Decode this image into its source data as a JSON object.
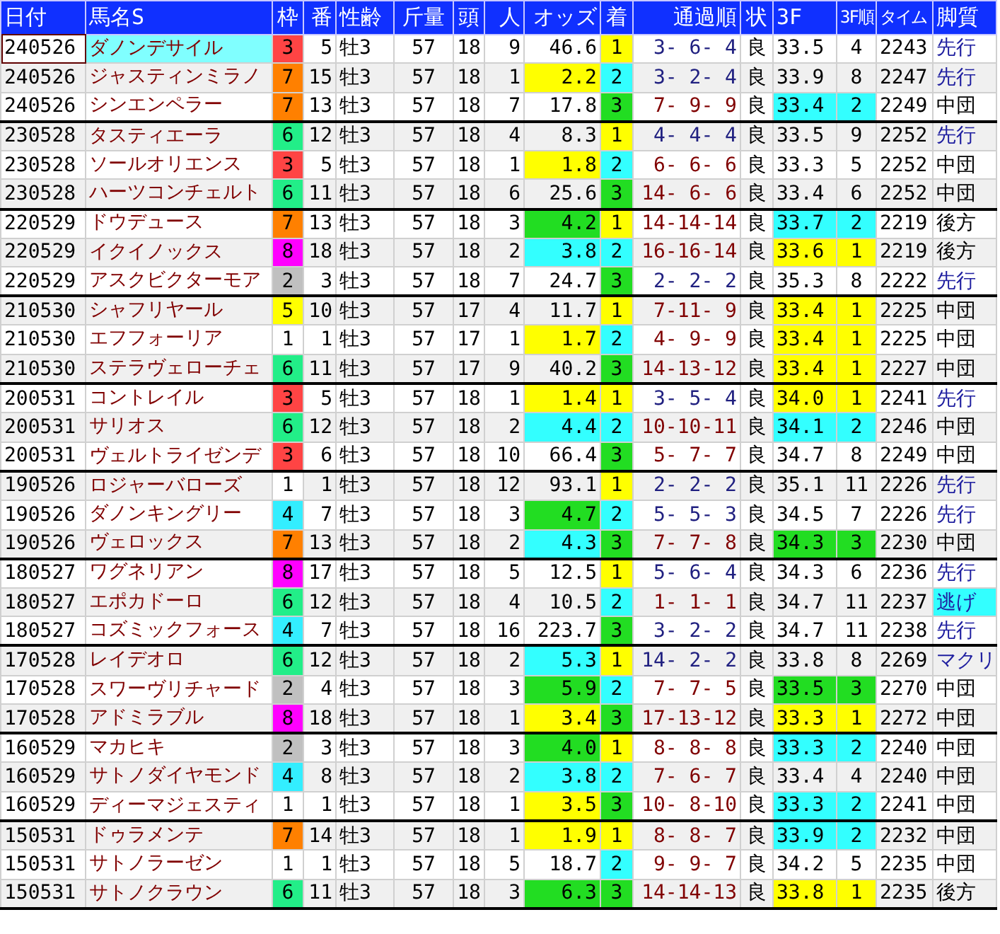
{
  "columns": [
    "日付",
    "馬名S",
    "枠",
    "番",
    "性齢",
    "斤量",
    "頭",
    "人",
    "オッズ",
    "着",
    "通過順",
    "状",
    "3F",
    "3F順",
    "タイム",
    "脚質"
  ],
  "races": [
    {
      "rows": [
        {
          "date": "240526",
          "name": "ダノンデサイル",
          "selected": true,
          "frame": {
            "text": "3",
            "color": "#ff4444"
          },
          "num": "5",
          "sex_age": "牡3",
          "weight": "57",
          "runners": "18",
          "pop": "9",
          "odds": {
            "text": "46.6"
          },
          "finish": {
            "text": "1",
            "color": "#ffff00"
          },
          "passing": {
            "text": "3- 6- 4",
            "color": "#202080"
          },
          "going": "良",
          "f3": {
            "text": "33.5"
          },
          "f3_rank": {
            "text": "4"
          },
          "time": "2243",
          "style": {
            "text": "先行",
            "color": "#2020a0",
            "highlighted": false
          }
        },
        {
          "date": "240526",
          "name": "ジャスティンミラノ",
          "selected": false,
          "frame": {
            "text": "7",
            "color": "#ff8000"
          },
          "num": "15",
          "sex_age": "牡3",
          "weight": "57",
          "runners": "18",
          "pop": "1",
          "odds": {
            "text": "2.2",
            "color": "#ffff00"
          },
          "finish": {
            "text": "2",
            "color": "#33ffff"
          },
          "passing": {
            "text": "3- 2- 4",
            "color": "#202080"
          },
          "going": "良",
          "f3": {
            "text": "33.9"
          },
          "f3_rank": {
            "text": "8"
          },
          "time": "2247",
          "style": {
            "text": "先行",
            "color": "#2020a0",
            "highlighted": false
          }
        },
        {
          "date": "240526",
          "name": "シンエンペラー",
          "selected": false,
          "frame": {
            "text": "7",
            "color": "#ff8000"
          },
          "num": "13",
          "sex_age": "牡3",
          "weight": "57",
          "runners": "18",
          "pop": "7",
          "odds": {
            "text": "17.8"
          },
          "finish": {
            "text": "3",
            "color": "#22dd22"
          },
          "passing": {
            "text": "7- 9- 9",
            "color": "#800000"
          },
          "going": "良",
          "f3": {
            "text": "33.4",
            "color": "#33ffff"
          },
          "f3_rank": {
            "text": "2",
            "color": "#33ffff"
          },
          "time": "2249",
          "style": {
            "text": "中団",
            "color": "#000000",
            "highlighted": false
          }
        }
      ]
    },
    {
      "rows": [
        {
          "date": "230528",
          "name": "タスティエーラ",
          "selected": false,
          "frame": {
            "text": "6",
            "color": "#22ee88"
          },
          "num": "12",
          "sex_age": "牡3",
          "weight": "57",
          "runners": "18",
          "pop": "4",
          "odds": {
            "text": "8.3"
          },
          "finish": {
            "text": "1",
            "color": "#ffff00"
          },
          "passing": {
            "text": "4- 4- 4",
            "color": "#202080"
          },
          "going": "良",
          "f3": {
            "text": "33.5"
          },
          "f3_rank": {
            "text": "9"
          },
          "time": "2252",
          "style": {
            "text": "先行",
            "color": "#2020a0",
            "highlighted": false
          }
        },
        {
          "date": "230528",
          "name": "ソールオリエンス",
          "selected": false,
          "frame": {
            "text": "3",
            "color": "#ff4444"
          },
          "num": "5",
          "sex_age": "牡3",
          "weight": "57",
          "runners": "18",
          "pop": "1",
          "odds": {
            "text": "1.8",
            "color": "#ffff00"
          },
          "finish": {
            "text": "2",
            "color": "#33ffff"
          },
          "passing": {
            "text": "6- 6- 6",
            "color": "#800000"
          },
          "going": "良",
          "f3": {
            "text": "33.3"
          },
          "f3_rank": {
            "text": "5"
          },
          "time": "2252",
          "style": {
            "text": "中団",
            "color": "#000000",
            "highlighted": false
          }
        },
        {
          "date": "230528",
          "name": "ハーツコンチェルト",
          "selected": false,
          "frame": {
            "text": "6",
            "color": "#22ee88"
          },
          "num": "11",
          "sex_age": "牡3",
          "weight": "57",
          "runners": "18",
          "pop": "6",
          "odds": {
            "text": "25.6"
          },
          "finish": {
            "text": "3",
            "color": "#22dd22"
          },
          "passing": {
            "text": "14- 6- 6",
            "color": "#800000"
          },
          "going": "良",
          "f3": {
            "text": "33.4"
          },
          "f3_rank": {
            "text": "6"
          },
          "time": "2252",
          "style": {
            "text": "中団",
            "color": "#000000",
            "highlighted": false
          }
        }
      ]
    },
    {
      "rows": [
        {
          "date": "220529",
          "name": "ドウデュース",
          "selected": false,
          "frame": {
            "text": "7",
            "color": "#ff8000"
          },
          "num": "13",
          "sex_age": "牡3",
          "weight": "57",
          "runners": "18",
          "pop": "3",
          "odds": {
            "text": "4.2",
            "color": "#22dd22"
          },
          "finish": {
            "text": "1",
            "color": "#ffff00"
          },
          "passing": {
            "text": "14-14-14",
            "color": "#800000"
          },
          "going": "良",
          "f3": {
            "text": "33.7",
            "color": "#33ffff"
          },
          "f3_rank": {
            "text": "2",
            "color": "#33ffff"
          },
          "time": "2219",
          "style": {
            "text": "後方",
            "color": "#000000",
            "highlighted": false
          }
        },
        {
          "date": "220529",
          "name": "イクイノックス",
          "selected": false,
          "frame": {
            "text": "8",
            "color": "#ff00ff"
          },
          "num": "18",
          "sex_age": "牡3",
          "weight": "57",
          "runners": "18",
          "pop": "2",
          "odds": {
            "text": "3.8",
            "color": "#33ffff"
          },
          "finish": {
            "text": "2",
            "color": "#33ffff"
          },
          "passing": {
            "text": "16-16-14",
            "color": "#800000"
          },
          "going": "良",
          "f3": {
            "text": "33.6",
            "color": "#ffff00"
          },
          "f3_rank": {
            "text": "1",
            "color": "#ffff00"
          },
          "time": "2219",
          "style": {
            "text": "後方",
            "color": "#000000",
            "highlighted": false
          }
        },
        {
          "date": "220529",
          "name": "アスクビクターモア",
          "selected": false,
          "frame": {
            "text": "2",
            "color": "#c0c0c0"
          },
          "num": "3",
          "sex_age": "牡3",
          "weight": "57",
          "runners": "18",
          "pop": "7",
          "odds": {
            "text": "24.7"
          },
          "finish": {
            "text": "3",
            "color": "#22dd22"
          },
          "passing": {
            "text": "2- 2- 2",
            "color": "#202080"
          },
          "going": "良",
          "f3": {
            "text": "35.3"
          },
          "f3_rank": {
            "text": "8"
          },
          "time": "2222",
          "style": {
            "text": "先行",
            "color": "#2020a0",
            "highlighted": false
          }
        }
      ]
    },
    {
      "rows": [
        {
          "date": "210530",
          "name": "シャフリヤール",
          "selected": false,
          "frame": {
            "text": "5",
            "color": "#ffff00"
          },
          "num": "10",
          "sex_age": "牡3",
          "weight": "57",
          "runners": "17",
          "pop": "4",
          "odds": {
            "text": "11.7"
          },
          "finish": {
            "text": "1",
            "color": "#ffff00"
          },
          "passing": {
            "text": "7-11- 9",
            "color": "#800000"
          },
          "going": "良",
          "f3": {
            "text": "33.4",
            "color": "#ffff00"
          },
          "f3_rank": {
            "text": "1",
            "color": "#ffff00"
          },
          "time": "2225",
          "style": {
            "text": "中団",
            "color": "#000000",
            "highlighted": false
          }
        },
        {
          "date": "210530",
          "name": "エフフォーリア",
          "selected": false,
          "frame": {
            "text": "1",
            "color": "#ffffff"
          },
          "num": "1",
          "sex_age": "牡3",
          "weight": "57",
          "runners": "17",
          "pop": "1",
          "odds": {
            "text": "1.7",
            "color": "#ffff00"
          },
          "finish": {
            "text": "2",
            "color": "#33ffff"
          },
          "passing": {
            "text": "4- 9- 9",
            "color": "#800000"
          },
          "going": "良",
          "f3": {
            "text": "33.4",
            "color": "#ffff00"
          },
          "f3_rank": {
            "text": "1",
            "color": "#ffff00"
          },
          "time": "2225",
          "style": {
            "text": "中団",
            "color": "#000000",
            "highlighted": false
          }
        },
        {
          "date": "210530",
          "name": "ステラヴェローチェ",
          "selected": false,
          "frame": {
            "text": "6",
            "color": "#22ee88"
          },
          "num": "11",
          "sex_age": "牡3",
          "weight": "57",
          "runners": "17",
          "pop": "9",
          "odds": {
            "text": "40.2"
          },
          "finish": {
            "text": "3",
            "color": "#22dd22"
          },
          "passing": {
            "text": "14-13-12",
            "color": "#800000"
          },
          "going": "良",
          "f3": {
            "text": "33.4",
            "color": "#ffff00"
          },
          "f3_rank": {
            "text": "1",
            "color": "#ffff00"
          },
          "time": "2227",
          "style": {
            "text": "中団",
            "color": "#000000",
            "highlighted": false
          }
        }
      ]
    },
    {
      "rows": [
        {
          "date": "200531",
          "name": "コントレイル",
          "selected": false,
          "frame": {
            "text": "3",
            "color": "#ff4444"
          },
          "num": "5",
          "sex_age": "牡3",
          "weight": "57",
          "runners": "18",
          "pop": "1",
          "odds": {
            "text": "1.4",
            "color": "#ffff00"
          },
          "finish": {
            "text": "1",
            "color": "#ffff00"
          },
          "passing": {
            "text": "3- 5- 4",
            "color": "#202080"
          },
          "going": "良",
          "f3": {
            "text": "34.0",
            "color": "#ffff00"
          },
          "f3_rank": {
            "text": "1",
            "color": "#ffff00"
          },
          "time": "2241",
          "style": {
            "text": "先行",
            "color": "#2020a0",
            "highlighted": false
          }
        },
        {
          "date": "200531",
          "name": "サリオス",
          "selected": false,
          "frame": {
            "text": "6",
            "color": "#22ee88"
          },
          "num": "12",
          "sex_age": "牡3",
          "weight": "57",
          "runners": "18",
          "pop": "2",
          "odds": {
            "text": "4.4",
            "color": "#33ffff"
          },
          "finish": {
            "text": "2",
            "color": "#33ffff"
          },
          "passing": {
            "text": "10-10-11",
            "color": "#800000"
          },
          "going": "良",
          "f3": {
            "text": "34.1",
            "color": "#33ffff"
          },
          "f3_rank": {
            "text": "2",
            "color": "#33ffff"
          },
          "time": "2246",
          "style": {
            "text": "中団",
            "color": "#000000",
            "highlighted": false
          }
        },
        {
          "date": "200531",
          "name": "ヴェルトライゼンデ",
          "selected": false,
          "frame": {
            "text": "3",
            "color": "#ff4444"
          },
          "num": "6",
          "sex_age": "牡3",
          "weight": "57",
          "runners": "18",
          "pop": "10",
          "odds": {
            "text": "66.4"
          },
          "finish": {
            "text": "3",
            "color": "#22dd22"
          },
          "passing": {
            "text": "5- 7- 7",
            "color": "#800000"
          },
          "going": "良",
          "f3": {
            "text": "34.7"
          },
          "f3_rank": {
            "text": "8"
          },
          "time": "2249",
          "style": {
            "text": "中団",
            "color": "#000000",
            "highlighted": false
          }
        }
      ]
    },
    {
      "rows": [
        {
          "date": "190526",
          "name": "ロジャーバローズ",
          "selected": false,
          "frame": {
            "text": "1",
            "color": "#ffffff"
          },
          "num": "1",
          "sex_age": "牡3",
          "weight": "57",
          "runners": "18",
          "pop": "12",
          "odds": {
            "text": "93.1"
          },
          "finish": {
            "text": "1",
            "color": "#ffff00"
          },
          "passing": {
            "text": "2- 2- 2",
            "color": "#202080"
          },
          "going": "良",
          "f3": {
            "text": "35.1"
          },
          "f3_rank": {
            "text": "11"
          },
          "time": "2226",
          "style": {
            "text": "先行",
            "color": "#2020a0",
            "highlighted": false
          }
        },
        {
          "date": "190526",
          "name": "ダノンキングリー",
          "selected": false,
          "frame": {
            "text": "4",
            "color": "#33eeff"
          },
          "num": "7",
          "sex_age": "牡3",
          "weight": "57",
          "runners": "18",
          "pop": "3",
          "odds": {
            "text": "4.7",
            "color": "#22dd22"
          },
          "finish": {
            "text": "2",
            "color": "#33ffff"
          },
          "passing": {
            "text": "5- 5- 3",
            "color": "#202080"
          },
          "going": "良",
          "f3": {
            "text": "34.5"
          },
          "f3_rank": {
            "text": "7"
          },
          "time": "2226",
          "style": {
            "text": "先行",
            "color": "#2020a0",
            "highlighted": false
          }
        },
        {
          "date": "190526",
          "name": "ヴェロックス",
          "selected": false,
          "frame": {
            "text": "7",
            "color": "#ff8000"
          },
          "num": "13",
          "sex_age": "牡3",
          "weight": "57",
          "runners": "18",
          "pop": "2",
          "odds": {
            "text": "4.3",
            "color": "#33ffff"
          },
          "finish": {
            "text": "3",
            "color": "#22dd22"
          },
          "passing": {
            "text": "7- 7- 8",
            "color": "#800000"
          },
          "going": "良",
          "f3": {
            "text": "34.3",
            "color": "#22dd22"
          },
          "f3_rank": {
            "text": "3",
            "color": "#22dd22"
          },
          "time": "2230",
          "style": {
            "text": "中団",
            "color": "#000000",
            "highlighted": false
          }
        }
      ]
    },
    {
      "rows": [
        {
          "date": "180527",
          "name": "ワグネリアン",
          "selected": false,
          "frame": {
            "text": "8",
            "color": "#ff00ff"
          },
          "num": "17",
          "sex_age": "牡3",
          "weight": "57",
          "runners": "18",
          "pop": "5",
          "odds": {
            "text": "12.5"
          },
          "finish": {
            "text": "1",
            "color": "#ffff00"
          },
          "passing": {
            "text": "5- 6- 4",
            "color": "#202080"
          },
          "going": "良",
          "f3": {
            "text": "34.3"
          },
          "f3_rank": {
            "text": "6"
          },
          "time": "2236",
          "style": {
            "text": "先行",
            "color": "#2020a0",
            "highlighted": false
          }
        },
        {
          "date": "180527",
          "name": "エポカドーロ",
          "selected": false,
          "frame": {
            "text": "6",
            "color": "#22ee88"
          },
          "num": "12",
          "sex_age": "牡3",
          "weight": "57",
          "runners": "18",
          "pop": "4",
          "odds": {
            "text": "10.5"
          },
          "finish": {
            "text": "2",
            "color": "#33ffff"
          },
          "passing": {
            "text": "1- 1- 1",
            "color": "#800000"
          },
          "going": "良",
          "f3": {
            "text": "34.7"
          },
          "f3_rank": {
            "text": "11"
          },
          "time": "2237",
          "style": {
            "text": "逃げ",
            "color": "#2020a0",
            "highlighted": true
          }
        },
        {
          "date": "180527",
          "name": "コズミックフォース",
          "selected": false,
          "frame": {
            "text": "4",
            "color": "#33eeff"
          },
          "num": "7",
          "sex_age": "牡3",
          "weight": "57",
          "runners": "18",
          "pop": "16",
          "odds": {
            "text": "223.7"
          },
          "finish": {
            "text": "3",
            "color": "#22dd22"
          },
          "passing": {
            "text": "3- 2- 2",
            "color": "#202080"
          },
          "going": "良",
          "f3": {
            "text": "34.7"
          },
          "f3_rank": {
            "text": "11"
          },
          "time": "2238",
          "style": {
            "text": "先行",
            "color": "#2020a0",
            "highlighted": false
          }
        }
      ]
    },
    {
      "rows": [
        {
          "date": "170528",
          "name": "レイデオロ",
          "selected": false,
          "frame": {
            "text": "6",
            "color": "#22ee88"
          },
          "num": "12",
          "sex_age": "牡3",
          "weight": "57",
          "runners": "18",
          "pop": "2",
          "odds": {
            "text": "5.3",
            "color": "#33ffff"
          },
          "finish": {
            "text": "1",
            "color": "#ffff00"
          },
          "passing": {
            "text": "14- 2- 2",
            "color": "#202080"
          },
          "going": "良",
          "f3": {
            "text": "33.8"
          },
          "f3_rank": {
            "text": "8"
          },
          "time": "2269",
          "style": {
            "text": "マクリ",
            "color": "#2020a0",
            "highlighted": false
          }
        },
        {
          "date": "170528",
          "name": "スワーヴリチャード",
          "selected": false,
          "frame": {
            "text": "2",
            "color": "#c0c0c0"
          },
          "num": "4",
          "sex_age": "牡3",
          "weight": "57",
          "runners": "18",
          "pop": "3",
          "odds": {
            "text": "5.9",
            "color": "#22dd22"
          },
          "finish": {
            "text": "2",
            "color": "#33ffff"
          },
          "passing": {
            "text": "7- 7- 5",
            "color": "#800000"
          },
          "going": "良",
          "f3": {
            "text": "33.5",
            "color": "#22dd22"
          },
          "f3_rank": {
            "text": "3",
            "color": "#22dd22"
          },
          "time": "2270",
          "style": {
            "text": "中団",
            "color": "#000000",
            "highlighted": false
          }
        },
        {
          "date": "170528",
          "name": "アドミラブル",
          "selected": false,
          "frame": {
            "text": "8",
            "color": "#ff00ff"
          },
          "num": "18",
          "sex_age": "牡3",
          "weight": "57",
          "runners": "18",
          "pop": "1",
          "odds": {
            "text": "3.4",
            "color": "#ffff00"
          },
          "finish": {
            "text": "3",
            "color": "#22dd22"
          },
          "passing": {
            "text": "17-13-12",
            "color": "#800000"
          },
          "going": "良",
          "f3": {
            "text": "33.3",
            "color": "#ffff00"
          },
          "f3_rank": {
            "text": "1",
            "color": "#ffff00"
          },
          "time": "2272",
          "style": {
            "text": "中団",
            "color": "#000000",
            "highlighted": false
          }
        }
      ]
    },
    {
      "rows": [
        {
          "date": "160529",
          "name": "マカヒキ",
          "selected": false,
          "frame": {
            "text": "2",
            "color": "#c0c0c0"
          },
          "num": "3",
          "sex_age": "牡3",
          "weight": "57",
          "runners": "18",
          "pop": "3",
          "odds": {
            "text": "4.0",
            "color": "#22dd22"
          },
          "finish": {
            "text": "1",
            "color": "#ffff00"
          },
          "passing": {
            "text": "8- 8- 8",
            "color": "#800000"
          },
          "going": "良",
          "f3": {
            "text": "33.3",
            "color": "#33ffff"
          },
          "f3_rank": {
            "text": "2",
            "color": "#33ffff"
          },
          "time": "2240",
          "style": {
            "text": "中団",
            "color": "#000000",
            "highlighted": false
          }
        },
        {
          "date": "160529",
          "name": "サトノダイヤモンド",
          "selected": false,
          "frame": {
            "text": "4",
            "color": "#33eeff"
          },
          "num": "8",
          "sex_age": "牡3",
          "weight": "57",
          "runners": "18",
          "pop": "2",
          "odds": {
            "text": "3.8",
            "color": "#33ffff"
          },
          "finish": {
            "text": "2",
            "color": "#33ffff"
          },
          "passing": {
            "text": "7- 6- 7",
            "color": "#800000"
          },
          "going": "良",
          "f3": {
            "text": "33.4"
          },
          "f3_rank": {
            "text": "4"
          },
          "time": "2240",
          "style": {
            "text": "中団",
            "color": "#000000",
            "highlighted": false
          }
        },
        {
          "date": "160529",
          "name": "ディーマジェスティ",
          "selected": false,
          "frame": {
            "text": "1",
            "color": "#ffffff"
          },
          "num": "1",
          "sex_age": "牡3",
          "weight": "57",
          "runners": "18",
          "pop": "1",
          "odds": {
            "text": "3.5",
            "color": "#ffff00"
          },
          "finish": {
            "text": "3",
            "color": "#22dd22"
          },
          "passing": {
            "text": "10- 8-10",
            "color": "#800000"
          },
          "going": "良",
          "f3": {
            "text": "33.3",
            "color": "#33ffff"
          },
          "f3_rank": {
            "text": "2",
            "color": "#33ffff"
          },
          "time": "2241",
          "style": {
            "text": "中団",
            "color": "#000000",
            "highlighted": false
          }
        }
      ]
    },
    {
      "rows": [
        {
          "date": "150531",
          "name": "ドゥラメンテ",
          "selected": false,
          "frame": {
            "text": "7",
            "color": "#ff8000"
          },
          "num": "14",
          "sex_age": "牡3",
          "weight": "57",
          "runners": "18",
          "pop": "1",
          "odds": {
            "text": "1.9",
            "color": "#ffff00"
          },
          "finish": {
            "text": "1",
            "color": "#ffff00"
          },
          "passing": {
            "text": "8- 8- 7",
            "color": "#800000"
          },
          "going": "良",
          "f3": {
            "text": "33.9",
            "color": "#33ffff"
          },
          "f3_rank": {
            "text": "2",
            "color": "#33ffff"
          },
          "time": "2232",
          "style": {
            "text": "中団",
            "color": "#000000",
            "highlighted": false
          }
        },
        {
          "date": "150531",
          "name": "サトノラーゼン",
          "selected": false,
          "frame": {
            "text": "1",
            "color": "#ffffff"
          },
          "num": "1",
          "sex_age": "牡3",
          "weight": "57",
          "runners": "18",
          "pop": "5",
          "odds": {
            "text": "18.7"
          },
          "finish": {
            "text": "2",
            "color": "#33ffff"
          },
          "passing": {
            "text": "9- 9- 7",
            "color": "#800000"
          },
          "going": "良",
          "f3": {
            "text": "34.2"
          },
          "f3_rank": {
            "text": "5"
          },
          "time": "2235",
          "style": {
            "text": "中団",
            "color": "#000000",
            "highlighted": false
          }
        },
        {
          "date": "150531",
          "name": "サトノクラウン",
          "selected": false,
          "frame": {
            "text": "6",
            "color": "#22ee88"
          },
          "num": "11",
          "sex_age": "牡3",
          "weight": "57",
          "runners": "18",
          "pop": "3",
          "odds": {
            "text": "6.3",
            "color": "#22dd22"
          },
          "finish": {
            "text": "3",
            "color": "#22dd22"
          },
          "passing": {
            "text": "14-14-13",
            "color": "#800000"
          },
          "going": "良",
          "f3": {
            "text": "33.8",
            "color": "#ffff00"
          },
          "f3_rank": {
            "text": "1",
            "color": "#ffff00"
          },
          "time": "2235",
          "style": {
            "text": "後方",
            "color": "#000000",
            "highlighted": false
          }
        }
      ]
    }
  ]
}
